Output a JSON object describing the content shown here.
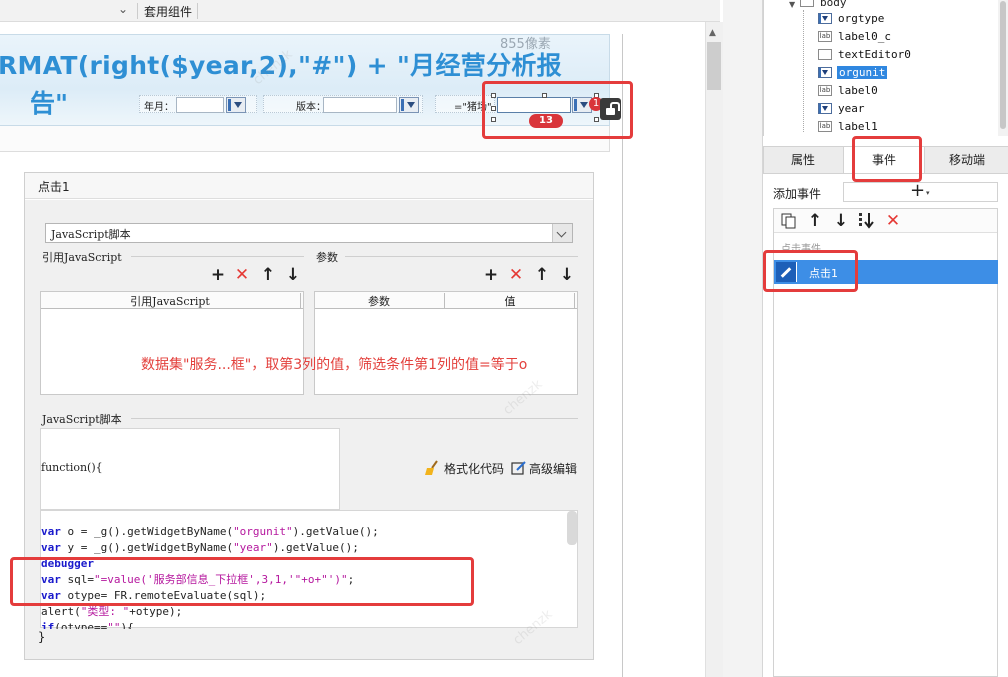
{
  "toolbar": {
    "chevron": "⌄",
    "tab_label": "套用组件"
  },
  "report": {
    "title_line1": "RMAT(right($year,2),\"#\") + \"月经营分析报",
    "title_line2": "告\"",
    "watermark_text": "855像素",
    "filters": [
      {
        "label": "年月："
      },
      {
        "label": "版本："
      },
      {
        "label": "=\"猪场\""
      }
    ],
    "selection_badge": "13",
    "selection_badge_right": "1"
  },
  "dialog": {
    "title": "点击1",
    "script_type": "JavaScript脚本",
    "ref_js_section": "引用JavaScript",
    "params_section": "参数",
    "ref_table_header": "引用JavaScript",
    "params_table_headers": [
      "参数",
      "值"
    ],
    "overlay_note": "数据集\"服务...框\"，取第3列的值，筛选条件第1列的值=等于o",
    "js_section": "JavaScript脚本",
    "function_signature": "function(){",
    "format_label": "格式化代码",
    "advanced_label": "高级编辑",
    "code_lines": [
      {
        "kw": "var",
        "rest_a": " o = _g().getWidgetByName(",
        "str": "\"orgunit\"",
        "rest_b": ").getValue();"
      },
      {
        "kw": "var",
        "rest_a": " y = _g().getWidgetByName(",
        "str": "\"year\"",
        "rest_b": ").getValue();"
      },
      {
        "kw": "debugger",
        "rest_a": "",
        "str": "",
        "rest_b": ""
      },
      {
        "kw": "var",
        "rest_a": " sql=",
        "str": "\"=value('服务部信息_下拉框',3,1,'\"+o+\"')\"",
        "rest_b": ";"
      },
      {
        "kw": "var",
        "rest_a": " otype= FR.remoteEvaluate(sql);",
        "str": "",
        "rest_b": ""
      },
      {
        "kw": "",
        "rest_a": "alert(",
        "str": "\"类型: \"",
        "rest_b": "+otype);"
      },
      {
        "kw": "if",
        "rest_a": "(otype==",
        "str": "\"\"",
        "rest_b": "){"
      }
    ],
    "closing_brace": "}"
  },
  "tree": {
    "root": "body",
    "items": [
      {
        "icon": "combo",
        "label": "orgtype"
      },
      {
        "icon": "lab",
        "label": "label0_c"
      },
      {
        "icon": "text",
        "label": "textEditor0"
      },
      {
        "icon": "combo",
        "label": "orgunit",
        "selected": true
      },
      {
        "icon": "lab",
        "label": "label0"
      },
      {
        "icon": "combo",
        "label": "year"
      },
      {
        "icon": "lab",
        "label": "label1"
      }
    ]
  },
  "tabs": [
    "属性",
    "事件",
    "移动端"
  ],
  "events": {
    "add_event_label": "添加事件",
    "add_plus": "+",
    "add_caret": "▾",
    "group_label": "点击事件",
    "item_label": "点击1"
  },
  "colors": {
    "title_blue": "#2e8fd4",
    "highlight_red": "#e43c3c",
    "selected_blue": "#3d8ee6"
  }
}
